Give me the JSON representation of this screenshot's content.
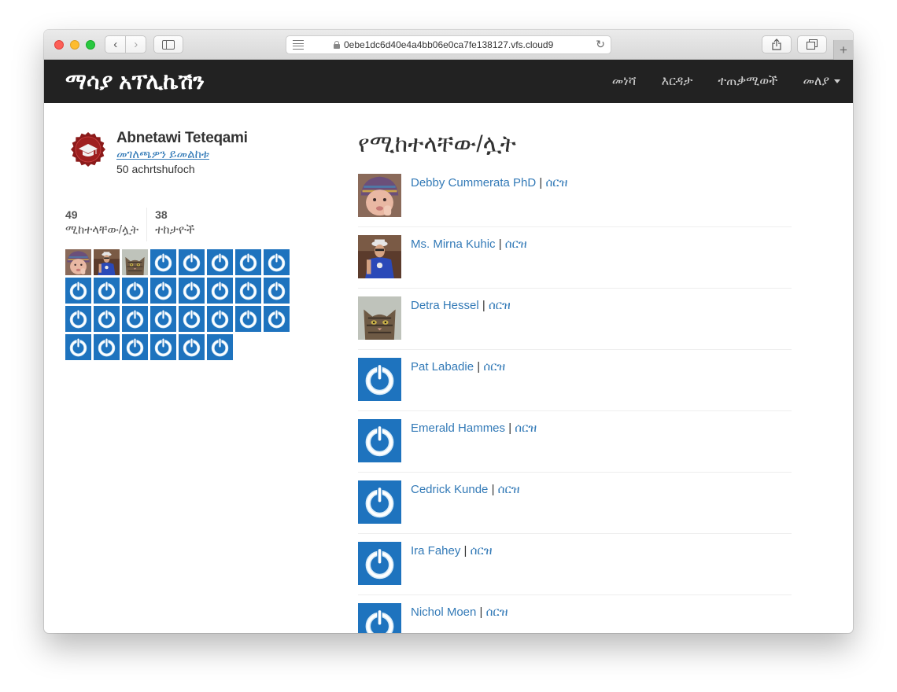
{
  "browser": {
    "url": "0ebe1dc6d40e4a4bb06e0ca7fe138127.vfs.cloud9"
  },
  "navbar": {
    "brand": "ማሳያ አፕሊኬሽን",
    "links": [
      "መነሻ",
      "እርዳታ",
      "ተጠቃሚወች"
    ],
    "dropdown_label": "መለያ"
  },
  "profile": {
    "name": "Abnetawi Teteqami",
    "edit_link": "መገለጫዎን ይመልከቱ",
    "posts_count": "50 achrtshufoch"
  },
  "stats": {
    "following_count": "49",
    "following_label": "ሚከተላቸው/ሏት",
    "followers_count": "38",
    "followers_label": "ተከታዮች"
  },
  "sidebar_avatars": [
    "baby-photo",
    "man-photo",
    "cat-photo",
    "default-gravatar",
    "default-gravatar",
    "default-gravatar",
    "default-gravatar",
    "default-gravatar",
    "default-gravatar",
    "default-gravatar",
    "default-gravatar",
    "default-gravatar",
    "default-gravatar",
    "default-gravatar",
    "default-gravatar",
    "default-gravatar",
    "default-gravatar",
    "default-gravatar",
    "default-gravatar",
    "default-gravatar",
    "default-gravatar",
    "default-gravatar",
    "default-gravatar",
    "default-gravatar",
    "default-gravatar",
    "default-gravatar",
    "default-gravatar",
    "default-gravatar",
    "default-gravatar",
    "default-gravatar"
  ],
  "main": {
    "title": "የሚከተላቸው/ሏት",
    "separator": "|",
    "delete_label": "ሰርዝ",
    "users": [
      {
        "name": "Debby Cummerata PhD",
        "avatar": "baby-photo"
      },
      {
        "name": "Ms. Mirna Kuhic",
        "avatar": "man-photo"
      },
      {
        "name": "Detra Hessel",
        "avatar": "cat-photo"
      },
      {
        "name": "Pat Labadie",
        "avatar": "default-gravatar"
      },
      {
        "name": "Emerald Hammes",
        "avatar": "default-gravatar"
      },
      {
        "name": "Cedrick Kunde",
        "avatar": "default-gravatar"
      },
      {
        "name": "Ira Fahey",
        "avatar": "default-gravatar"
      },
      {
        "name": "Nichol Moen",
        "avatar": "default-gravatar"
      }
    ]
  },
  "colors": {
    "navbar_bg": "#222222",
    "link": "#337ab7",
    "gravatar_blue": "#1e73be",
    "profile_badge": "#8b1a1a"
  }
}
